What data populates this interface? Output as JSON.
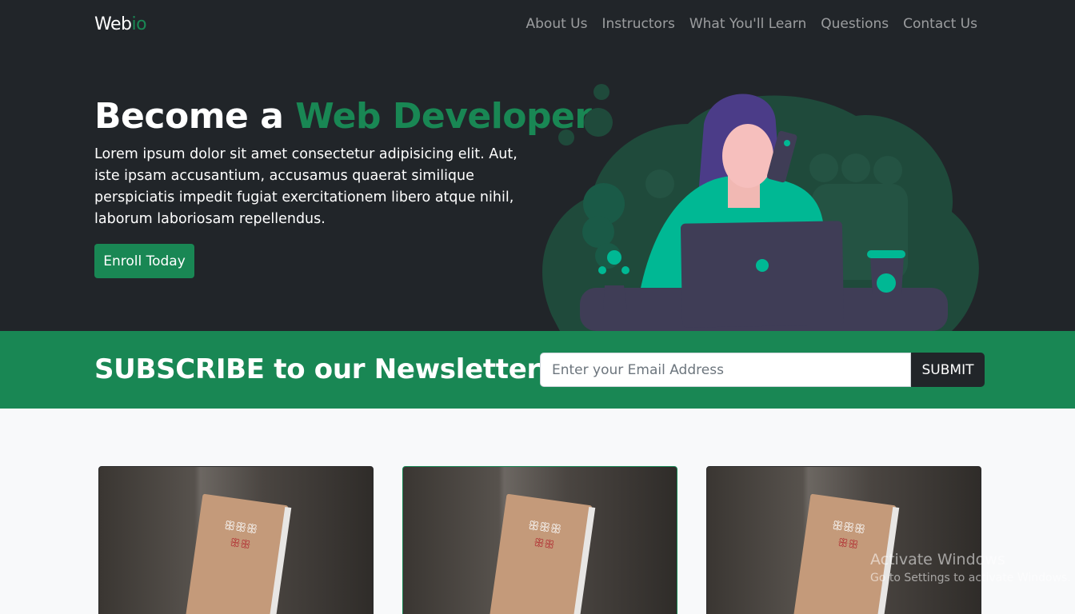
{
  "brand": {
    "name_main": "Web",
    "name_accent": "io"
  },
  "nav": [
    "About Us",
    "Instructors",
    "What You'll Learn",
    "Questions",
    "Contact Us"
  ],
  "hero": {
    "title_main": "Become a ",
    "title_accent": "Web Developer",
    "text": "Lorem ipsum dolor sit amet consectetur adipisicing elit. Aut, iste ipsam accusantium, accusamus quaerat similique perspiciatis impedit fugiat exercitationem libero atque nihil, laborum laboriosam repellendus.",
    "button": "Enroll Today"
  },
  "newsletter": {
    "title": "SUBSCRIBE to our Newsletter",
    "placeholder": "Enter your Email Address",
    "submit": "SUBMIT"
  },
  "cards": [
    {
      "image": "book-image"
    },
    {
      "image": "book-image"
    },
    {
      "image": "book-image"
    }
  ],
  "watermark": {
    "line1": "Activate Windows",
    "line2": "Go to Settings to activate Windows."
  },
  "colors": {
    "accent": "#198754",
    "dark": "#212529",
    "teal": "#00b894",
    "purple": "#3f3d56"
  }
}
